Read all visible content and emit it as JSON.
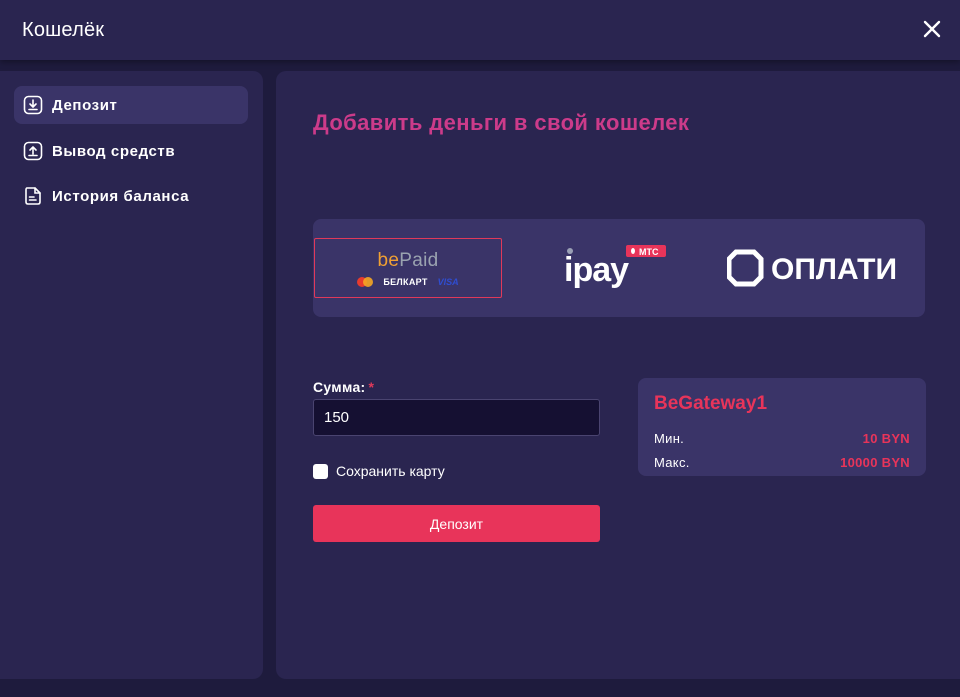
{
  "header": {
    "title": "Кошелёк",
    "close_icon": "close-icon"
  },
  "sidebar": {
    "items": [
      {
        "label": "Депозит",
        "icon": "download-icon",
        "active": true
      },
      {
        "label": "Вывод средств",
        "icon": "upload-icon",
        "active": false
      },
      {
        "label": "История баланса",
        "icon": "document-icon",
        "active": false
      }
    ]
  },
  "main": {
    "title": "Добавить деньги в свой кошелек",
    "providers": [
      {
        "be": "be",
        "paid": "Paid",
        "sub_belkart": "БЕЛКАРТ",
        "sub_visa": "VISA",
        "selected": true
      },
      {
        "name": "ipay",
        "badge": "МТС",
        "selected": false
      },
      {
        "name": "ОПЛАТИ",
        "selected": false
      }
    ],
    "amount": {
      "label": "Сумма:",
      "required_mark": "*",
      "value": "150"
    },
    "save_card_label": "Сохранить карту",
    "deposit_button": "Депозит",
    "gateway": {
      "name": "BeGateway1",
      "min_label": "Мин.",
      "min_value": "10 BYN",
      "max_label": "Макс.",
      "max_value": "10000 BYN"
    }
  },
  "colors": {
    "background": "#1e1b3d",
    "panel": "#2a2550",
    "accent_pink": "#cc3b8a",
    "accent_red": "#e8345a"
  }
}
